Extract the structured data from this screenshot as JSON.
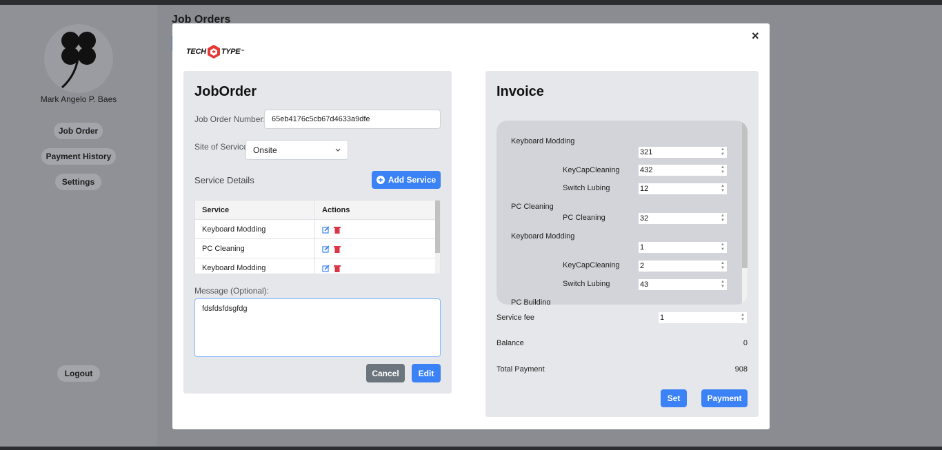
{
  "background": {
    "page_title": "Job Orders",
    "user_name": "Mark Angelo P. Baes",
    "nav": [
      "Job Order",
      "Payment History",
      "Settings"
    ],
    "logout_label": "Logout"
  },
  "modal": {
    "close_glyph": "×",
    "logo": {
      "left": "TECH",
      "right": "TYPE",
      "tm": "™"
    },
    "joborder": {
      "title": "JobOrder",
      "job_number_label": "Job Order Number:",
      "job_number_value": "65eb4176c5cb67d4633a9dfe",
      "site_label": "Site of Service:",
      "site_value": "Onsite",
      "service_details_label": "Service Details",
      "add_service_label": "Add Service",
      "table": {
        "headers": [
          "Service",
          "Actions"
        ],
        "rows": [
          "Keyboard Modding",
          "PC Cleaning",
          "Keyboard Modding"
        ]
      },
      "message_label": "Message (Optional):",
      "message_value": "fdsfdsfdsgfdg",
      "cancel_label": "Cancel",
      "edit_label": "Edit"
    },
    "invoice": {
      "title": "Invoice",
      "items": {
        "g1_name": "Keyboard Modding",
        "g1_qty": "321",
        "g1_sub1_name": "KeyCapCleaning",
        "g1_sub1_qty": "432",
        "g1_sub2_name": "Switch Lubing",
        "g1_sub2_qty": "12",
        "g2_name": "PC Cleaning",
        "g2_sub1_name": "PC Cleaning",
        "g2_sub1_qty": "32",
        "g3_name": "Keyboard Modding",
        "g3_qty": "1",
        "g3_sub1_name": "KeyCapCleaning",
        "g3_sub1_qty": "2",
        "g3_sub2_name": "Switch Lubing",
        "g3_sub2_qty": "43",
        "g4_name": "PC Building"
      },
      "service_fee_label": "Service fee",
      "service_fee_value": "1",
      "balance_label": "Balance",
      "balance_value": "0",
      "total_label": "Total Payment",
      "total_value": "908",
      "set_label": "Set",
      "payment_label": "Payment"
    }
  },
  "colors": {
    "primary": "#3b82f6",
    "danger": "#dc3545",
    "secondary": "#6c757d",
    "panel": "#e6e7ea"
  }
}
